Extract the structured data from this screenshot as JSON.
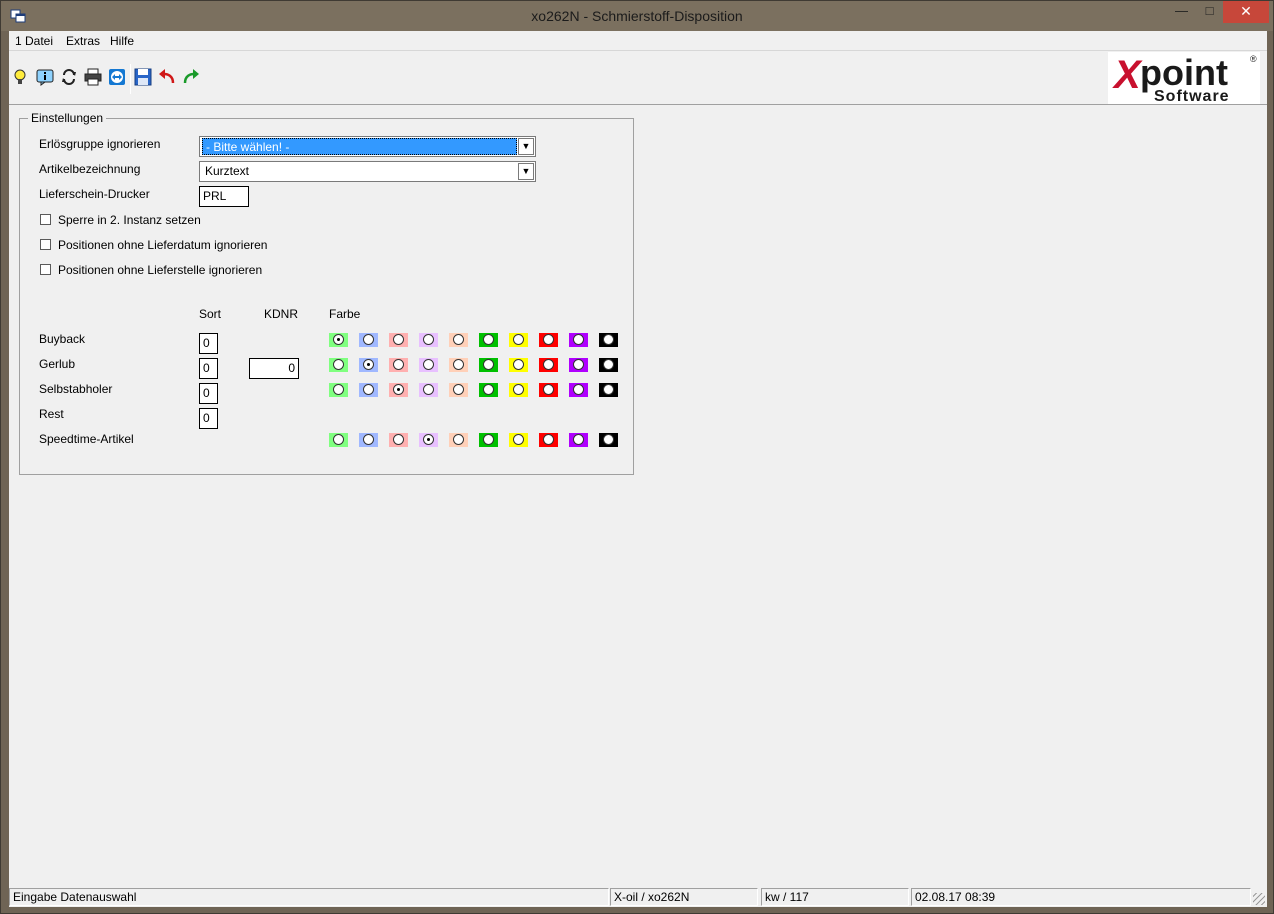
{
  "window": {
    "title": "xo262N - Schmierstoff-Disposition",
    "min_label": "—",
    "max_label": "□",
    "close_label": "✕"
  },
  "menu": {
    "items": [
      "1 Datei",
      "Extras",
      "Hilfe"
    ]
  },
  "toolbar": {
    "icons": [
      "lightbulb-icon",
      "info-icon",
      "refresh-icon",
      "printer-icon",
      "teamviewer-icon",
      "save-icon",
      "undo-icon",
      "redo-icon"
    ]
  },
  "logo": {
    "brand": "Xpoint",
    "sub": "Software",
    "reg": "®",
    "colors": {
      "x": "#c8102e",
      "text": "#1a1a1a"
    }
  },
  "settings": {
    "legend": "Einstellungen",
    "erloesgruppe_label": "Erlösgruppe ignorieren",
    "erloesgruppe_value": "- Bitte wählen! -",
    "artikelbezeichnung_label": "Artikelbezeichnung",
    "artikelbezeichnung_value": "Kurztext",
    "drucker_label": "Lieferschein-Drucker",
    "drucker_value": "PRL",
    "checkboxes": [
      {
        "label": "Sperre in 2. Instanz setzen",
        "checked": false
      },
      {
        "label": "Positionen ohne Lieferdatum ignorieren",
        "checked": false
      },
      {
        "label": "Positionen ohne Lieferstelle ignorieren",
        "checked": false
      }
    ],
    "col_sort": "Sort",
    "col_kdnr": "KDNR",
    "col_farbe": "Farbe",
    "palette": [
      "#80ff80",
      "#a0b8ff",
      "#ffb0b0",
      "#e8c0ff",
      "#ffd0b8",
      "#00c000",
      "#ffff00",
      "#ff0000",
      "#b000ff",
      "#000000"
    ],
    "rows": [
      {
        "label": "Buyback",
        "sort": "0",
        "kdnr": null,
        "color_index": 0,
        "has_colors": true
      },
      {
        "label": "Gerlub",
        "sort": "0",
        "kdnr": "0",
        "color_index": 1,
        "has_colors": true
      },
      {
        "label": "Selbstabholer",
        "sort": "0",
        "kdnr": null,
        "color_index": 2,
        "has_colors": true
      },
      {
        "label": "Rest",
        "sort": "0",
        "kdnr": null,
        "color_index": -1,
        "has_colors": false
      },
      {
        "label": "Speedtime-Artikel",
        "sort": null,
        "kdnr": null,
        "color_index": 3,
        "has_colors": true
      }
    ]
  },
  "status": {
    "message": "Eingabe Datenauswahl",
    "module": "X-oil / xo262N",
    "week": "kw / 117",
    "datetime": "02.08.17 08:39"
  }
}
